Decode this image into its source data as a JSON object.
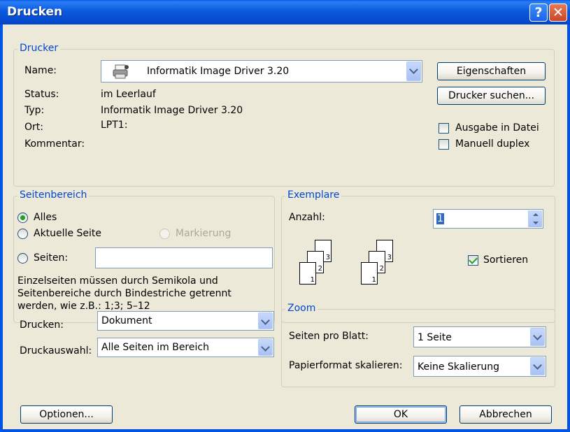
{
  "window": {
    "title": "Drucken",
    "help_glyph": "?",
    "close_glyph": "✕"
  },
  "printer_group": {
    "legend": "Drucker",
    "name_label": "Name:",
    "name_value": "Informatik Image Driver 3.20",
    "status_label": "Status:",
    "status_value": "im Leerlauf",
    "type_label": "Typ:",
    "type_value": "Informatik Image Driver 3.20",
    "location_label": "Ort:",
    "location_value": "LPT1:",
    "comment_label": "Kommentar:",
    "properties_button": "Eigenschaften",
    "find_printer_button": "Drucker suchen...",
    "print_to_file_label": "Ausgabe in Datei",
    "print_to_file_checked": false,
    "manual_duplex_label": "Manuell duplex",
    "manual_duplex_checked": false
  },
  "page_range": {
    "legend": "Seitenbereich",
    "all_label": "Alles",
    "current_page_label": "Aktuelle Seite",
    "selection_label": "Markierung",
    "pages_label": "Seiten:",
    "pages_value": "",
    "help_line1": "Einzelseiten müssen durch Semikola und",
    "help_line2": "Seitenbereiche durch Bindestriche getrennt",
    "help_line3": "werden, wie z.B.: 1;3; 5–12",
    "selected": "all"
  },
  "copies": {
    "legend": "Exemplare",
    "count_label": "Anzahl:",
    "count_value": "1",
    "collate_label": "Sortieren",
    "collate_checked": true,
    "page_numbers": [
      "3",
      "2",
      "1"
    ]
  },
  "print_options": {
    "print_label": "Drucken:",
    "print_value": "Dokument",
    "print_what_label": "Druckauswahl:",
    "print_what_value": "Alle Seiten im Bereich"
  },
  "zoom": {
    "legend": "Zoom",
    "pages_per_sheet_label": "Seiten pro Blatt:",
    "pages_per_sheet_value": "1 Seite",
    "scale_label": "Papierformat skalieren:",
    "scale_value": "Keine Skalierung"
  },
  "footer": {
    "options_button": "Optionen...",
    "ok_button": "OK",
    "cancel_button": "Abbrechen"
  },
  "icons": {
    "printer": "printer-icon",
    "help": "help-icon",
    "close": "close-icon"
  }
}
